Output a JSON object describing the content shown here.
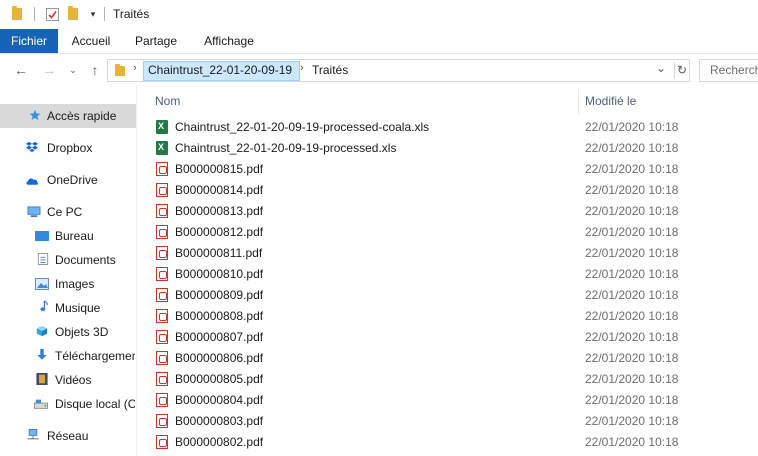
{
  "window": {
    "title": "Traités",
    "qa_icons": [
      "folder-icon",
      "properties-icon",
      "new-folder-icon",
      "customize-quick-access-icon"
    ]
  },
  "ribbon": {
    "tabs": [
      "Fichier",
      "Accueil",
      "Partage",
      "Affichage"
    ]
  },
  "address": {
    "crumbs": [
      "Chaintrust_22-01-20-09-19",
      "Traités"
    ]
  },
  "search": {
    "placeholder": "Rechercher"
  },
  "sidebar": {
    "items": [
      {
        "label": "Accès rapide",
        "icon": "star-icon"
      },
      {
        "label": "Dropbox",
        "icon": "dropbox-icon"
      },
      {
        "label": "OneDrive",
        "icon": "cloud-icon"
      },
      {
        "label": "Ce PC",
        "icon": "computer-icon"
      },
      {
        "label": "Bureau",
        "icon": "desktop-icon"
      },
      {
        "label": "Documents",
        "icon": "documents-icon"
      },
      {
        "label": "Images",
        "icon": "images-icon"
      },
      {
        "label": "Musique",
        "icon": "music-icon"
      },
      {
        "label": "Objets 3D",
        "icon": "objects3d-icon"
      },
      {
        "label": "Téléchargements",
        "icon": "download-icon"
      },
      {
        "label": "Vidéos",
        "icon": "videos-icon"
      },
      {
        "label": "Disque local (C:)",
        "icon": "disk-icon"
      },
      {
        "label": "Réseau",
        "icon": "network-icon"
      }
    ]
  },
  "columns": {
    "name": "Nom",
    "modified": "Modifié le"
  },
  "files": [
    {
      "name": "Chaintrust_22-01-20-09-19-processed-coala.xls",
      "date": "22/01/2020 10:18",
      "type": "xls"
    },
    {
      "name": "Chaintrust_22-01-20-09-19-processed.xls",
      "date": "22/01/2020 10:18",
      "type": "xls"
    },
    {
      "name": "B000000815.pdf",
      "date": "22/01/2020 10:18",
      "type": "pdf"
    },
    {
      "name": "B000000814.pdf",
      "date": "22/01/2020 10:18",
      "type": "pdf"
    },
    {
      "name": "B000000813.pdf",
      "date": "22/01/2020 10:18",
      "type": "pdf"
    },
    {
      "name": "B000000812.pdf",
      "date": "22/01/2020 10:18",
      "type": "pdf"
    },
    {
      "name": "B000000811.pdf",
      "date": "22/01/2020 10:18",
      "type": "pdf"
    },
    {
      "name": "B000000810.pdf",
      "date": "22/01/2020 10:18",
      "type": "pdf"
    },
    {
      "name": "B000000809.pdf",
      "date": "22/01/2020 10:18",
      "type": "pdf"
    },
    {
      "name": "B000000808.pdf",
      "date": "22/01/2020 10:18",
      "type": "pdf"
    },
    {
      "name": "B000000807.pdf",
      "date": "22/01/2020 10:18",
      "type": "pdf"
    },
    {
      "name": "B000000806.pdf",
      "date": "22/01/2020 10:18",
      "type": "pdf"
    },
    {
      "name": "B000000805.pdf",
      "date": "22/01/2020 10:18",
      "type": "pdf"
    },
    {
      "name": "B000000804.pdf",
      "date": "22/01/2020 10:18",
      "type": "pdf"
    },
    {
      "name": "B000000803.pdf",
      "date": "22/01/2020 10:18",
      "type": "pdf"
    },
    {
      "name": "B000000802.pdf",
      "date": "22/01/2020 10:18",
      "type": "pdf"
    }
  ],
  "colors": {
    "accent": "#1764b5",
    "selection": "#cce8ff",
    "active_nav": "#d9d9d9"
  }
}
